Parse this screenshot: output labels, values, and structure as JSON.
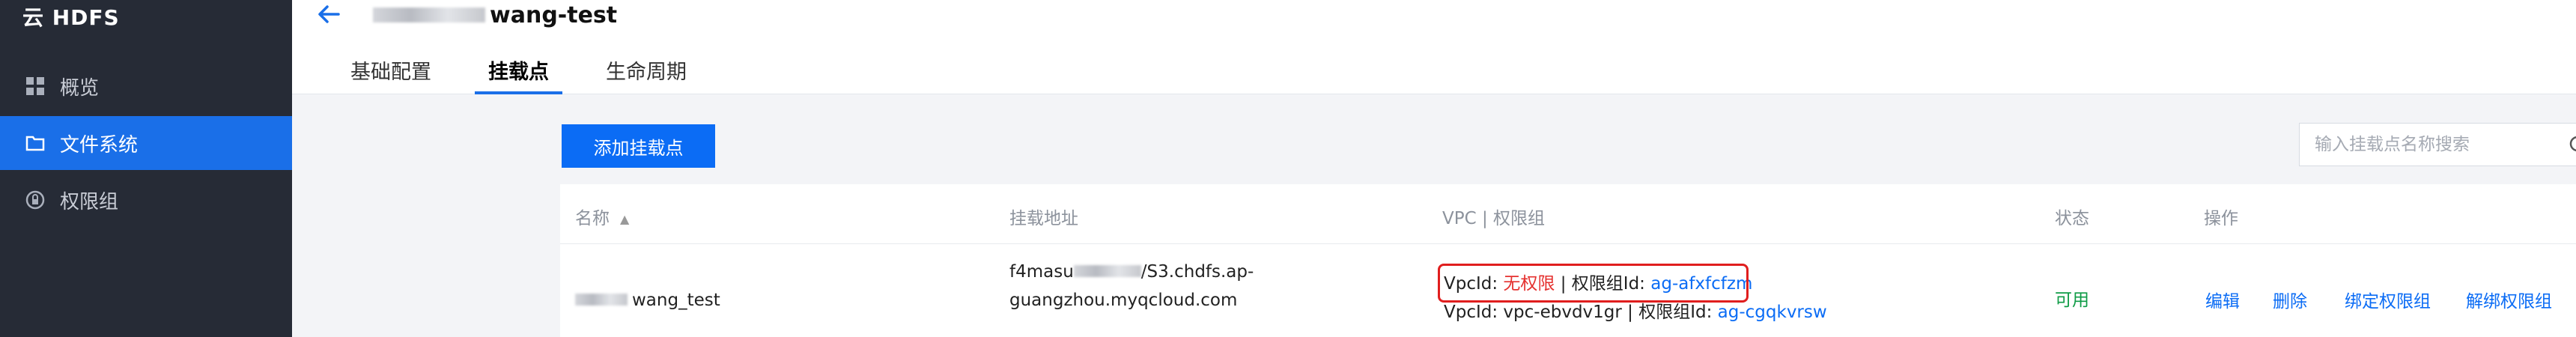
{
  "sidebar": {
    "brand": "云 HDFS",
    "items": [
      {
        "label": "概览",
        "icon": "grid-icon"
      },
      {
        "label": "文件系统",
        "icon": "folder-icon"
      },
      {
        "label": "权限组",
        "icon": "permission-icon"
      }
    ]
  },
  "header": {
    "title": "wang-test",
    "tabs": [
      {
        "label": "基础配置"
      },
      {
        "label": "挂载点"
      },
      {
        "label": "生命周期"
      }
    ]
  },
  "toolbar": {
    "add_label": "添加挂载点",
    "search_placeholder": "输入挂载点名称搜索"
  },
  "table": {
    "columns": [
      "名称",
      "挂载地址",
      "VPC | 权限组",
      "状态",
      "操作"
    ],
    "rows": [
      {
        "name": "wang_test",
        "address_line1": "f4masu",
        "address_line1b": "/S3.chdfs.ap-",
        "address_line2": "guangzhou.myqcloud.com",
        "vpc1_prefix": "VpcId: ",
        "vpc1_value": "无权限",
        "vpc1_mid": " | 权限组Id: ",
        "vpc1_group": "ag-afxfcfzm",
        "vpc2_prefix": "VpcId: vpc-ebvdv1gr | 权限组Id: ",
        "vpc2_group": "ag-cgqkvrsw",
        "status": "可用",
        "ops": [
          "编辑",
          "删除",
          "绑定权限组",
          "解绑权限组"
        ]
      }
    ]
  },
  "colors": {
    "accent": "#0b6cf5",
    "sidebar_bg": "#262b36",
    "error": "#e5312f",
    "success": "#0e9b45"
  }
}
